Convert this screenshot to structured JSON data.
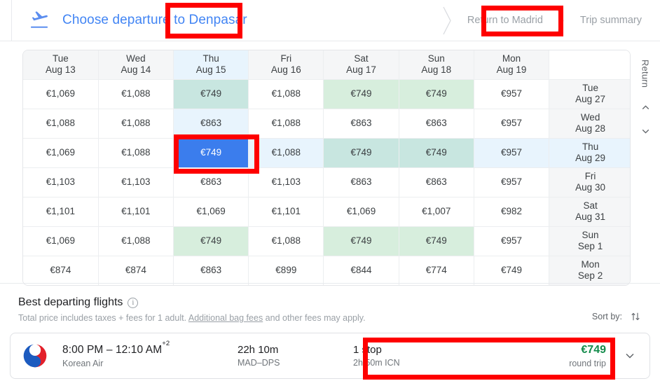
{
  "header": {
    "plane_icon": "flight-takeoff-icon",
    "title_prefix": "Choose departure to ",
    "destination": "Denpasar",
    "crumbs": [
      {
        "label": "Return to Madrid",
        "highlighted": true
      },
      {
        "label": "Trip summary",
        "highlighted": false
      }
    ]
  },
  "price_grid": {
    "columns": [
      {
        "day": "Tue",
        "date": "Aug 13",
        "selected": false
      },
      {
        "day": "Wed",
        "date": "Aug 14",
        "selected": false
      },
      {
        "day": "Thu",
        "date": "Aug 15",
        "selected": true
      },
      {
        "day": "Fri",
        "date": "Aug 16",
        "selected": false
      },
      {
        "day": "Sat",
        "date": "Aug 17",
        "selected": false
      },
      {
        "day": "Sun",
        "date": "Aug 18",
        "selected": false
      },
      {
        "day": "Mon",
        "date": "Aug 19",
        "selected": false
      }
    ],
    "return_header": "",
    "rows": [
      {
        "return_day": "Tue",
        "return_date": "Aug 27",
        "return_selected": false,
        "cells": [
          {
            "value": "€1,069",
            "tone": "red",
            "tint": "none"
          },
          {
            "value": "€1,088",
            "tone": "red",
            "tint": "none"
          },
          {
            "value": "€749",
            "tone": "green",
            "tint": "teal"
          },
          {
            "value": "€1,088",
            "tone": "red",
            "tint": "none"
          },
          {
            "value": "€749",
            "tone": "green",
            "tint": "green"
          },
          {
            "value": "€749",
            "tone": "green",
            "tint": "green"
          },
          {
            "value": "€957",
            "tone": "dark",
            "tint": "none"
          }
        ]
      },
      {
        "return_day": "Wed",
        "return_date": "Aug 28",
        "return_selected": false,
        "cells": [
          {
            "value": "€1,088",
            "tone": "red",
            "tint": "none"
          },
          {
            "value": "€1,088",
            "tone": "red",
            "tint": "none"
          },
          {
            "value": "€863",
            "tone": "dark",
            "tint": "blue"
          },
          {
            "value": "€1,088",
            "tone": "red",
            "tint": "none"
          },
          {
            "value": "€863",
            "tone": "dark",
            "tint": "none"
          },
          {
            "value": "€863",
            "tone": "dark",
            "tint": "none"
          },
          {
            "value": "€957",
            "tone": "dark",
            "tint": "none"
          }
        ]
      },
      {
        "return_day": "Thu",
        "return_date": "Aug 29",
        "return_selected": true,
        "cells": [
          {
            "value": "€1,069",
            "tone": "red",
            "tint": "none",
            "selected": false
          },
          {
            "value": "€1,088",
            "tone": "red",
            "tint": "none",
            "selected": false
          },
          {
            "value": "€749",
            "tone": "white",
            "tint": "none",
            "selected": true
          },
          {
            "value": "€1,088",
            "tone": "red",
            "tint": "blue",
            "selected": false
          },
          {
            "value": "€749",
            "tone": "green",
            "tint": "teal",
            "selected": false
          },
          {
            "value": "€749",
            "tone": "green",
            "tint": "teal",
            "selected": false
          },
          {
            "value": "€957",
            "tone": "dark",
            "tint": "blue",
            "selected": false
          }
        ]
      },
      {
        "return_day": "Fri",
        "return_date": "Aug 30",
        "return_selected": false,
        "cells": [
          {
            "value": "€1,103",
            "tone": "red",
            "tint": "none"
          },
          {
            "value": "€1,103",
            "tone": "red",
            "tint": "none"
          },
          {
            "value": "€863",
            "tone": "dark",
            "tint": "none"
          },
          {
            "value": "€1,103",
            "tone": "red",
            "tint": "none"
          },
          {
            "value": "€863",
            "tone": "dark",
            "tint": "none"
          },
          {
            "value": "€863",
            "tone": "dark",
            "tint": "none"
          },
          {
            "value": "€957",
            "tone": "dark",
            "tint": "none"
          }
        ]
      },
      {
        "return_day": "Sat",
        "return_date": "Aug 31",
        "return_selected": false,
        "cells": [
          {
            "value": "€1,101",
            "tone": "red",
            "tint": "none"
          },
          {
            "value": "€1,101",
            "tone": "red",
            "tint": "none"
          },
          {
            "value": "€1,069",
            "tone": "red",
            "tint": "none"
          },
          {
            "value": "€1,101",
            "tone": "red",
            "tint": "none"
          },
          {
            "value": "€1,069",
            "tone": "red",
            "tint": "none"
          },
          {
            "value": "€1,007",
            "tone": "dark",
            "tint": "none"
          },
          {
            "value": "€982",
            "tone": "dark",
            "tint": "none"
          }
        ]
      },
      {
        "return_day": "Sun",
        "return_date": "Sep 1",
        "return_selected": false,
        "cells": [
          {
            "value": "€1,069",
            "tone": "red",
            "tint": "none"
          },
          {
            "value": "€1,088",
            "tone": "red",
            "tint": "none"
          },
          {
            "value": "€749",
            "tone": "green",
            "tint": "green"
          },
          {
            "value": "€1,088",
            "tone": "red",
            "tint": "none"
          },
          {
            "value": "€749",
            "tone": "green",
            "tint": "green"
          },
          {
            "value": "€749",
            "tone": "green",
            "tint": "green"
          },
          {
            "value": "€957",
            "tone": "dark",
            "tint": "none"
          }
        ]
      },
      {
        "return_day": "Mon",
        "return_date": "Sep 2",
        "return_selected": false,
        "cells": [
          {
            "value": "€874",
            "tone": "dark",
            "tint": "none"
          },
          {
            "value": "€874",
            "tone": "dark",
            "tint": "none"
          },
          {
            "value": "€863",
            "tone": "dark",
            "tint": "none"
          },
          {
            "value": "€899",
            "tone": "dark",
            "tint": "none"
          },
          {
            "value": "€844",
            "tone": "dark",
            "tint": "none"
          },
          {
            "value": "€774",
            "tone": "green",
            "tint": "none"
          },
          {
            "value": "€749",
            "tone": "green",
            "tint": "none"
          }
        ]
      }
    ],
    "rail": {
      "label": "Return",
      "up_icon": "chevron-up-icon",
      "down_icon": "chevron-down-icon"
    }
  },
  "best_flights": {
    "title": "Best departing flights",
    "info_icon": "info-icon",
    "subtitle_pre": "Total price includes taxes + fees for 1 adult. ",
    "subtitle_link": "Additional bag fees",
    "subtitle_post": " and other fees may apply.",
    "sort_label": "Sort by:",
    "sort_icon": "sort-arrows-icon",
    "results": [
      {
        "logo": "korean-air-logo",
        "times": "8:00 PM – 12:10 AM",
        "day_offset": "+2",
        "airline": "Korean Air",
        "duration": "22h 10m",
        "route": "MAD–DPS",
        "stops": "1 stop",
        "layover": "2h 50m ICN",
        "price": "€749",
        "price_sub": "round trip",
        "expand_icon": "chevron-down-icon"
      }
    ]
  },
  "annotations": {
    "color": "#fe0000",
    "boxes": [
      "destination-highlight",
      "return-crumb-highlight",
      "selected-price-cell-highlight",
      "result-summary-highlight"
    ]
  }
}
